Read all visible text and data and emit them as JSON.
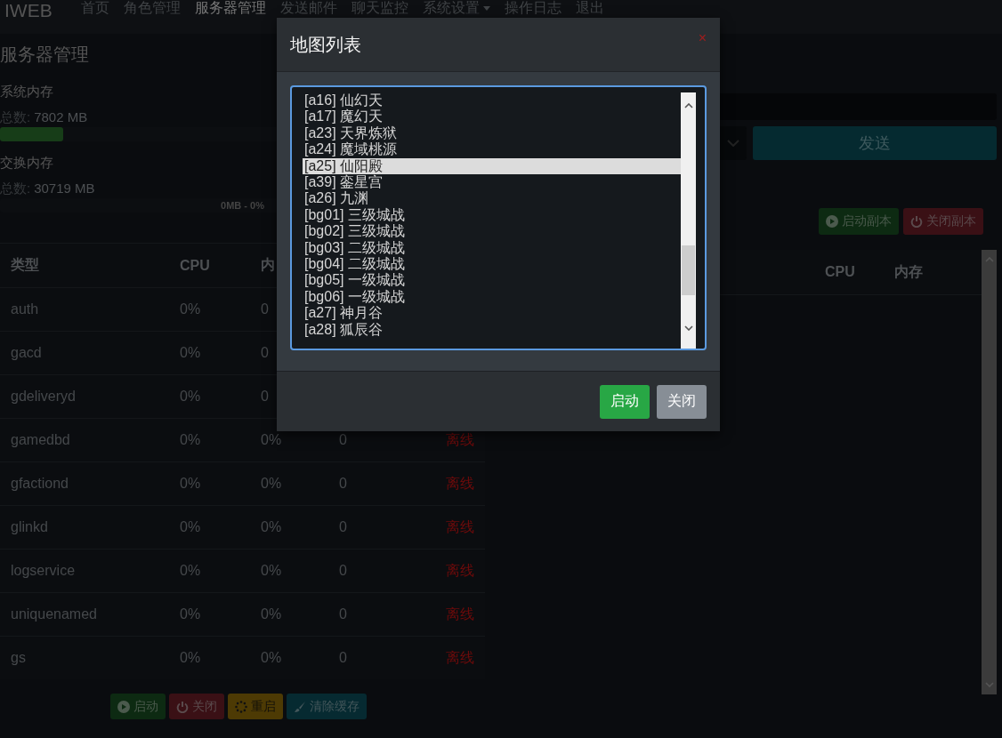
{
  "navbar": {
    "brand": "IWEB",
    "items": [
      {
        "label": "首页",
        "selected": false,
        "dropdown": false
      },
      {
        "label": "角色管理",
        "selected": false,
        "dropdown": false
      },
      {
        "label": "服务器管理",
        "selected": true,
        "dropdown": false
      },
      {
        "label": "发送邮件",
        "selected": false,
        "dropdown": false
      },
      {
        "label": "聊天监控",
        "selected": false,
        "dropdown": false
      },
      {
        "label": "系统设置",
        "selected": false,
        "dropdown": true
      },
      {
        "label": "操作日志",
        "selected": false,
        "dropdown": false
      },
      {
        "label": "退出",
        "selected": false,
        "dropdown": false
      }
    ]
  },
  "page_title": "服务器管理",
  "memory": [
    {
      "title": "系统内存",
      "total_label": "总数:",
      "total": "7802 MB",
      "level": 0.13
    },
    {
      "title": "交换内存",
      "total_label": "总数:",
      "total": "30719 MB",
      "bar_text": "0MB - 0%"
    }
  ],
  "process_table": {
    "columns": [
      "类型",
      "CPU",
      "内"
    ],
    "rows": [
      {
        "type": "auth",
        "cpu": "0%",
        "memory": "0"
      },
      {
        "type": "gacd",
        "cpu": "0%",
        "memory": "0"
      },
      {
        "type": "gdeliveryd",
        "cpu": "0%",
        "memory": "0"
      },
      {
        "type": "gamedbd",
        "cpu": "0%",
        "memory": "0%",
        "column_4": "0",
        "status": "离线"
      },
      {
        "type": "gfactiond",
        "cpu": "0%",
        "memory": "0%",
        "column_4": "0",
        "status": "离线"
      },
      {
        "type": "glinkd",
        "cpu": "0%",
        "memory": "0%",
        "column_4": "0",
        "status": "离线"
      },
      {
        "type": "logservice",
        "cpu": "0%",
        "memory": "0%",
        "column_4": "0",
        "status": "离线"
      },
      {
        "type": "uniquenamed",
        "cpu": "0%",
        "memory": "0%",
        "column_4": "0",
        "status": "离线"
      },
      {
        "type": "gs",
        "cpu": "0%",
        "memory": "0%",
        "column_4": "0",
        "status": "离线"
      }
    ]
  },
  "process_buttons": [
    {
      "label": "启动",
      "kind": "start"
    },
    {
      "label": "关闭",
      "kind": "stop"
    },
    {
      "label": "重启",
      "kind": "restart"
    },
    {
      "label": "清除缓存",
      "kind": "clear"
    }
  ],
  "send_button": "发送",
  "instance_buttons": [
    {
      "label": "启动副本",
      "kind": "start"
    },
    {
      "label": "关闭副本",
      "kind": "stop"
    }
  ],
  "instance_table": {
    "columns": [
      "CPU",
      "内存"
    ]
  },
  "modal": {
    "title": "地图列表",
    "close": "×",
    "maps": [
      {
        "label": "[a16] 仙幻天",
        "selected": false
      },
      {
        "label": "[a17] 魔幻天",
        "selected": false
      },
      {
        "label": "[a23] 天界炼狱",
        "selected": false
      },
      {
        "label": "[a24] 魔域桃源",
        "selected": false
      },
      {
        "label": "[a25] 仙阳殿",
        "selected": true
      },
      {
        "label": "[a39] 銮星宫",
        "selected": false
      },
      {
        "label": "[a26] 九渊",
        "selected": false
      },
      {
        "label": "[bg01] 三级城战",
        "selected": false
      },
      {
        "label": "[bg02] 三级城战",
        "selected": false
      },
      {
        "label": "[bg03] 二级城战",
        "selected": false
      },
      {
        "label": "[bg04] 二级城战",
        "selected": false
      },
      {
        "label": "[bg05] 一级城战",
        "selected": false
      },
      {
        "label": "[bg06] 一级城战",
        "selected": false
      },
      {
        "label": "[a27] 神月谷",
        "selected": false
      },
      {
        "label": "[a28] 狐辰谷",
        "selected": false
      }
    ],
    "buttons": [
      {
        "label": "启动",
        "kind": "primary"
      },
      {
        "label": "关闭",
        "kind": "secondary"
      }
    ]
  }
}
